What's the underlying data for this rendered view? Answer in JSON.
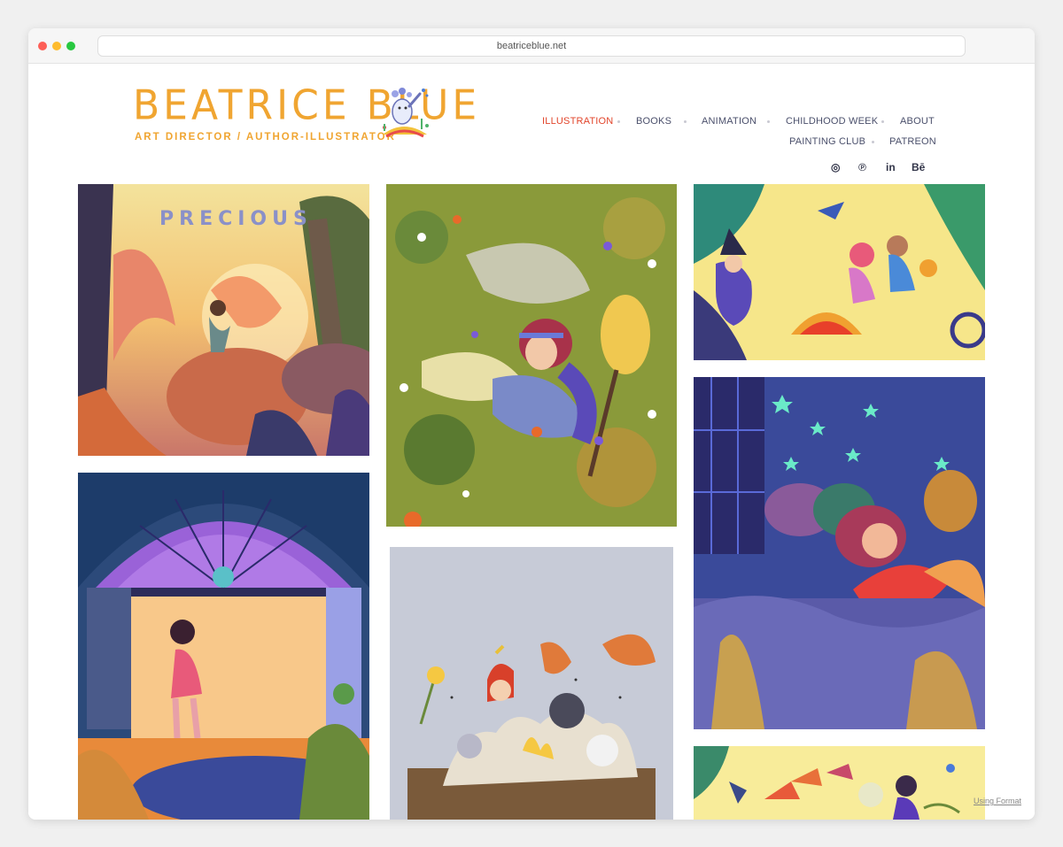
{
  "browser": {
    "url": "beatriceblue.net"
  },
  "logo": {
    "name": "BEATRICE BLUE",
    "subtitle": "ART DIRECTOR / AUTHOR-ILLUSTRATOR",
    "color": "#f0a531"
  },
  "nav": {
    "row1": [
      "ILLUSTRATION",
      "BOOKS",
      "ANIMATION",
      "CHILDHOOD WEEK",
      "ABOUT"
    ],
    "row2": [
      "PAINTING CLUB",
      "PATREON"
    ],
    "active": "ILLUSTRATION",
    "active_color": "#e2452b"
  },
  "social": [
    {
      "icon": "instagram-icon",
      "glyph": "◎"
    },
    {
      "icon": "pinterest-icon",
      "glyph": "℗"
    },
    {
      "icon": "linkedin-icon",
      "glyph": "in"
    },
    {
      "icon": "behance-icon",
      "glyph": "Bē"
    }
  ],
  "gallery": {
    "tile1_text": "PRECIOUS"
  },
  "footer": {
    "format_link": "Using Format"
  }
}
